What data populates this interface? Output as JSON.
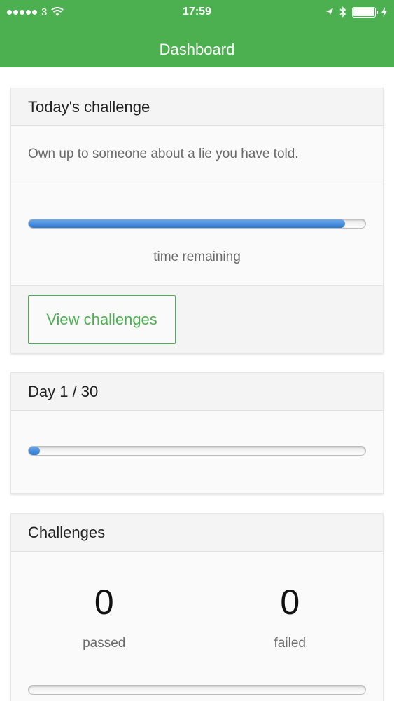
{
  "status_bar": {
    "carrier": "3",
    "time": "17:59"
  },
  "nav": {
    "title": "Dashboard"
  },
  "challenge_card": {
    "title": "Today's challenge",
    "text": "Own up to someone about a lie you have told.",
    "time_progress": 0.94,
    "caption": "time remaining",
    "button_label": "View challenges"
  },
  "day_card": {
    "title": "Day 1 / 30",
    "day_progress": 0.033
  },
  "challenges_card": {
    "title": "Challenges",
    "passed_count": "0",
    "passed_label": "passed",
    "failed_count": "0",
    "failed_label": "failed",
    "pass_progress": 0
  },
  "colors": {
    "accent": "#4caf50",
    "progress_blue": "#2f78d0"
  }
}
